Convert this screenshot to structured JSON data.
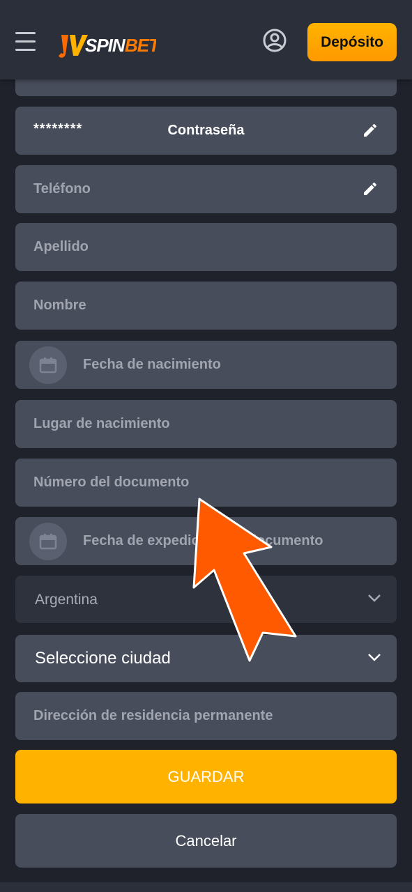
{
  "header": {
    "logo_text": "JVSPINBET",
    "deposit_label": "Depósito"
  },
  "form": {
    "password_value": "********",
    "password_title": "Contraseña",
    "phone_placeholder": "Teléfono",
    "surname_placeholder": "Apellido",
    "name_placeholder": "Nombre",
    "birthdate_placeholder": "Fecha de nacimiento",
    "birthplace_placeholder": "Lugar de nacimiento",
    "document_number_placeholder": "Número del documento",
    "document_issue_date_placeholder": "Fecha de expedición del documento",
    "country_value": "Argentina",
    "city_value": "Seleccione ciudad",
    "address_placeholder": "Dirección de residencia permanente",
    "save_label": "GUARDAR",
    "cancel_label": "Cancelar"
  },
  "colors": {
    "accent": "#ffb300",
    "field_bg": "#474d5b",
    "page_bg": "#1f222b",
    "annotation_arrow": "#ff5a00"
  }
}
